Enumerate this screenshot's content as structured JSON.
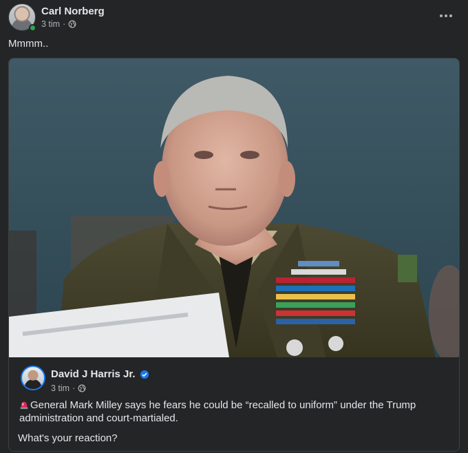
{
  "post": {
    "author": "Carl Norberg",
    "time": "3 tim",
    "visibility_icon": "globe-icon",
    "more_icon": "more-options-icon",
    "caption": "Mmmm..",
    "online": true
  },
  "shared_post": {
    "photo_icon": "news-photo",
    "author": "David J Harris Jr.",
    "verified": true,
    "time": "3 tim",
    "visibility_icon": "globe-icon",
    "text": "General Mark Milley says he fears he could be “recalled to uniform” under the Trump administration and court-martialed.",
    "lead_icon": "police-light-icon",
    "question": "What's your reaction?"
  },
  "colors": {
    "background": "#242526",
    "text_primary": "#e4e6eb",
    "text_secondary": "#b0b3b8",
    "verified_blue": "#1877f2",
    "online_green": "#31a24c"
  }
}
